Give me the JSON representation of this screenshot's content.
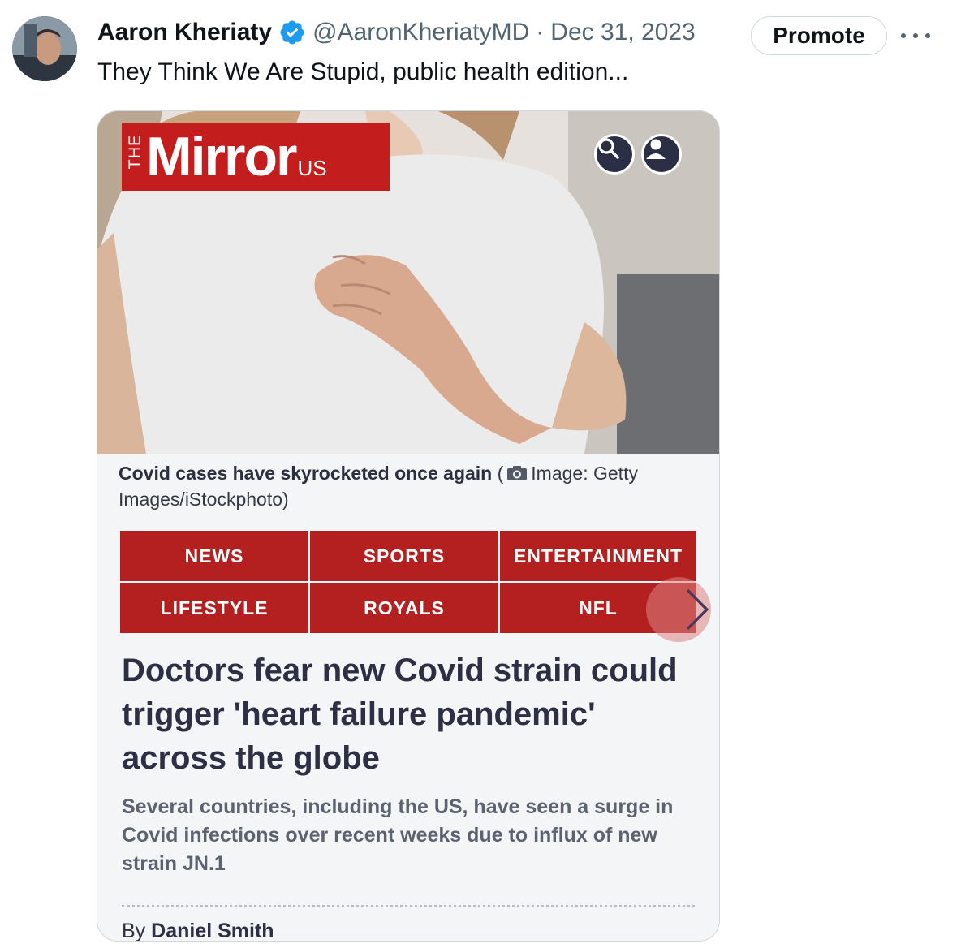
{
  "author": {
    "name": "Aaron Kheriaty",
    "handle": "@AaronKheriatyMD",
    "separator": "·",
    "date": "Dec 31, 2023",
    "verified": true
  },
  "actions": {
    "promote_label": "Promote",
    "more_icon": "more-horizontal-icon"
  },
  "tweet": {
    "text": "They Think We Are Stupid, public health edition..."
  },
  "article": {
    "logo": {
      "the": "THE",
      "brand": "Mirror",
      "region": "US"
    },
    "caption_bold": "Covid cases have skyrocketed once again",
    "caption_paren_open": "(",
    "caption_rest": "Image: Getty Images/iStockphoto)",
    "nav": [
      "NEWS",
      "SPORTS",
      "ENTERTAINMENT",
      "LIFESTYLE",
      "ROYALS",
      "NFL"
    ],
    "headline": "Doctors fear new Covid strain could trigger 'heart failure pandemic' across the globe",
    "summary": "Several countries, including the US, have seen a surge in Covid infections over recent weeks due to influx of new strain JN.1",
    "byline_prefix": "By",
    "byline_author": "Daniel Smith"
  },
  "colors": {
    "mirror_red": "#c41d1d",
    "nav_red": "#b3201f",
    "verified_blue": "#1d9bf0",
    "headline_navy": "#2d2f44",
    "muted_text": "#536471"
  }
}
